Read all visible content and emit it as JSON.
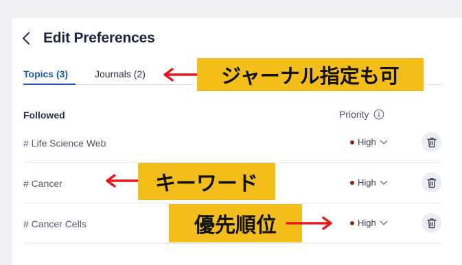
{
  "header": {
    "title": "Edit Preferences"
  },
  "tabs": [
    {
      "label": "Topics (3)",
      "active": true
    },
    {
      "label": "Journals (2)",
      "active": false
    }
  ],
  "list": {
    "followed_label": "Followed",
    "priority_label": "Priority",
    "rows": [
      {
        "label": "# Life Science Web",
        "priority": "High"
      },
      {
        "label": "# Cancer",
        "priority": "High"
      },
      {
        "label": "# Cancer Cells",
        "priority": "High"
      }
    ]
  },
  "callouts": {
    "journals": "ジャーナル指定も可",
    "keyword": "キーワード",
    "priority": "優先順位"
  },
  "colors": {
    "accent": "#1e5bb8",
    "priority_dot": "#8b2a12",
    "callout_bg": "#f4be1a",
    "arrow": "#e8151b"
  }
}
